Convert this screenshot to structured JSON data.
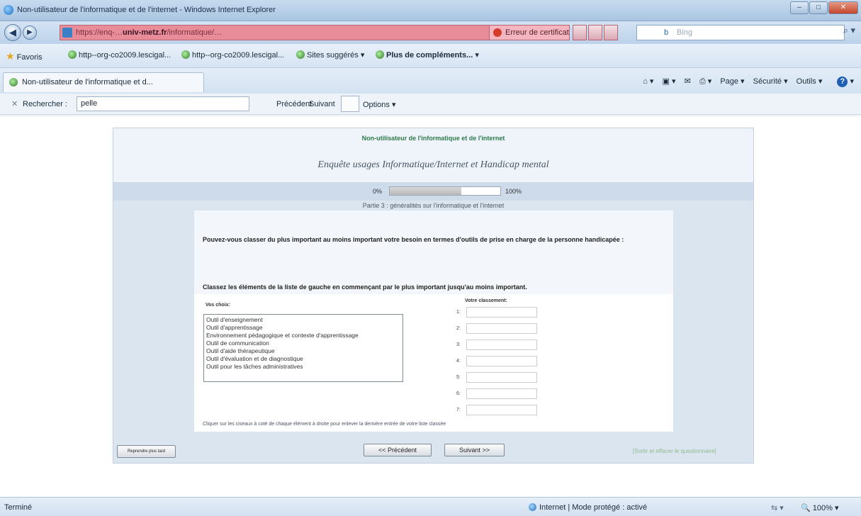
{
  "window": {
    "title": "Non-utilisateur de l'informatique et de l'internet - Windows Internet Explorer",
    "buttons": [
      "–",
      "□",
      "✕"
    ]
  },
  "nav": {
    "back_icon": "back-arrow-icon",
    "forward_icon": "forward-arrow-icon",
    "url_domain": "univ-metz.fr",
    "cert_error": "Erreur de certificat",
    "search_placeholder": "Bing",
    "search_engine_label": "b"
  },
  "favorites": {
    "label": "Favoris",
    "items": [
      "http--org-co2009.lescigal...",
      "http--org-co2009.lescigal...",
      "Sites suggérés ▾",
      "Plus de compléments... ▾"
    ]
  },
  "tab": {
    "label": "Non-utilisateur de l'informatique et d..."
  },
  "commandbar": {
    "items": [
      "Page ▾",
      "Sécurité ▾",
      "Outils ▾"
    ]
  },
  "findbar": {
    "label": "Rechercher :",
    "value": "pelle",
    "previous": "Précédent",
    "next": "Suivant",
    "options": "Options ▾"
  },
  "survey": {
    "subtitle": "Non-utilisateur de l'informatique et de l'internet",
    "title": "Enquête usages Informatique/Internet et Handicap mental",
    "progress_left": "0%",
    "progress_right": "100%",
    "progress_value": 0.65,
    "part": "Partie 3 : généralités sur l'informatique et l'internet",
    "question": "Pouvez-vous classer du plus important au moins important votre besoin en termes d'outils de prise en charge de la personne handicapée :",
    "instruction": "Classez les éléments de la liste de gauche en commençant par le plus important jusqu'au moins important.",
    "choices_label": "Vos choix:",
    "choices": [
      "Outil d'enseignement",
      "Outil d'apprentissage",
      "Environnement pédagogique et contexte d'apprentissage",
      "Outil de communication",
      "Outil d'aide thérapeutique",
      "Outil d'évaluation et de diagnostique",
      "Outil pour les tâches administratives"
    ],
    "ranking_label": "Votre classement:",
    "ranks": [
      "1:",
      "2:",
      "3:",
      "4:",
      "5:",
      "6:",
      "7:"
    ],
    "hint": "Cliquer sur les ciseaux à coté de chaque élément à droite pour enlever la dernière entrée de votre liste classée",
    "later_button": "Reprendre plus tard",
    "prev_button": "<< Précédent",
    "next_button": "Suivant >>",
    "exit_link": "[Sortir et effacer le questionnaire]"
  },
  "statusbar": {
    "left": "Terminé",
    "zone": "Internet | Mode protégé : activé",
    "zoom": "100%"
  }
}
